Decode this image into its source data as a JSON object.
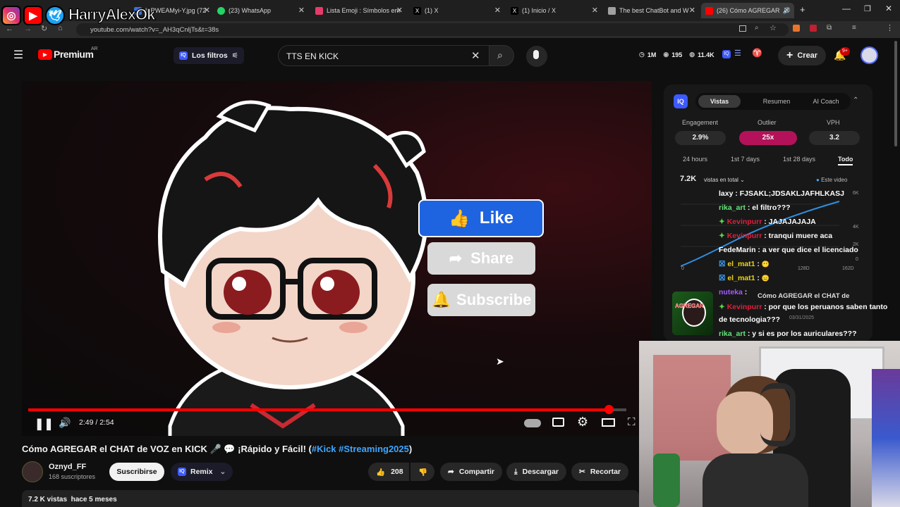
{
  "browser": {
    "tabs": [
      {
        "label": "lFRWEAMyi-Y.jpg (72",
        "color": "#3b6fd8"
      },
      {
        "label": "(23) WhatsApp",
        "color": "#25d366"
      },
      {
        "label": "Lista Emoji : Símbolos em",
        "color": "#e63b6a"
      },
      {
        "label": "(1) X",
        "color": "#000000"
      },
      {
        "label": "(1) Inicio / X",
        "color": "#000000"
      },
      {
        "label": "The best ChatBot and W",
        "color": "#a0a0a0"
      },
      {
        "label": "(26) Cómo AGREGAR",
        "color": "#ff0000"
      }
    ],
    "url": "youtube.com/watch?v=_AH3qCnljTs&t=38s"
  },
  "overlay_logo": {
    "handle": "HarryAlexOk",
    "icons": [
      "instagram-icon",
      "youtube-icon",
      "twitter-icon"
    ]
  },
  "header": {
    "brand": "Premium",
    "region": "AR",
    "filters_label": "Los filtros",
    "search_value": "TTS EN KICK",
    "stats": {
      "s1": "1M",
      "s2": "195",
      "s3": "11.4K"
    },
    "create_label": "Crear",
    "notif_badge": "9+"
  },
  "video": {
    "like_label": "Like",
    "share_label": "Share",
    "subscribe_label": "Subscribe",
    "time": "2:49 / 2:54",
    "progress": 0.97
  },
  "title": "Cómo AGREGAR el CHAT de VOZ en KICK 🎤 💬 ¡Rápido y Fácil! (",
  "title_tags": "#Kick #Streaming2025",
  "title_end": ")",
  "channel": {
    "name": "Oznyd_FF",
    "subs": "168 suscriptores",
    "subscribe": "Suscribirse",
    "remix": "Remix"
  },
  "actions": {
    "likes": "208",
    "share": "Compartir",
    "download": "Descargar",
    "clip": "Recortar"
  },
  "meta": "7.2 K vistas  hace 5 meses",
  "panel": {
    "tabs": [
      "Vistas",
      "Resumen",
      "AI Coach"
    ],
    "metrics": [
      {
        "label": "Engagement",
        "value": "2.9%"
      },
      {
        "label": "Outlier",
        "value": "25x"
      },
      {
        "label": "VPH",
        "value": "3.2"
      }
    ],
    "ranges": [
      "24 hours",
      "1st 7 days",
      "1st 28 days",
      "Todo"
    ],
    "total": "7.2K",
    "total_label": "vistas en total",
    "legend": "Este video",
    "yticks": [
      "6K",
      "4K",
      "2K",
      "0"
    ],
    "xticks": [
      "0",
      "128D",
      "162D"
    ],
    "mini_title": "Cómo AGREGAR el CHAT de",
    "mini_date": "03/31/2025"
  },
  "chat": [
    {
      "user": "laxy",
      "text": " : FJSAKL;JDSAKLJAFHLKASJ"
    },
    {
      "user": "rika_art",
      "text": " : el filtro???"
    },
    {
      "user": "Kevinpurr",
      "text": " : JAJAJAJAJA"
    },
    {
      "user": "Kevinpurr",
      "text": " : tranqui muere aca"
    },
    {
      "user": "FedeMarin",
      "text": " : a ver que dice el licenciado"
    },
    {
      "user": "el_mat1",
      "text": " : "
    },
    {
      "user": "el_mat1",
      "text": " : "
    },
    {
      "user": "nuteka",
      "text": " : "
    },
    {
      "user": "Kevinpurr",
      "text": " : por que los peruanos saben tanto"
    },
    {
      "user": "",
      "text": "de tecnologia???"
    },
    {
      "user": "rika_art",
      "text": " : y si es por los auriculares???"
    }
  ]
}
